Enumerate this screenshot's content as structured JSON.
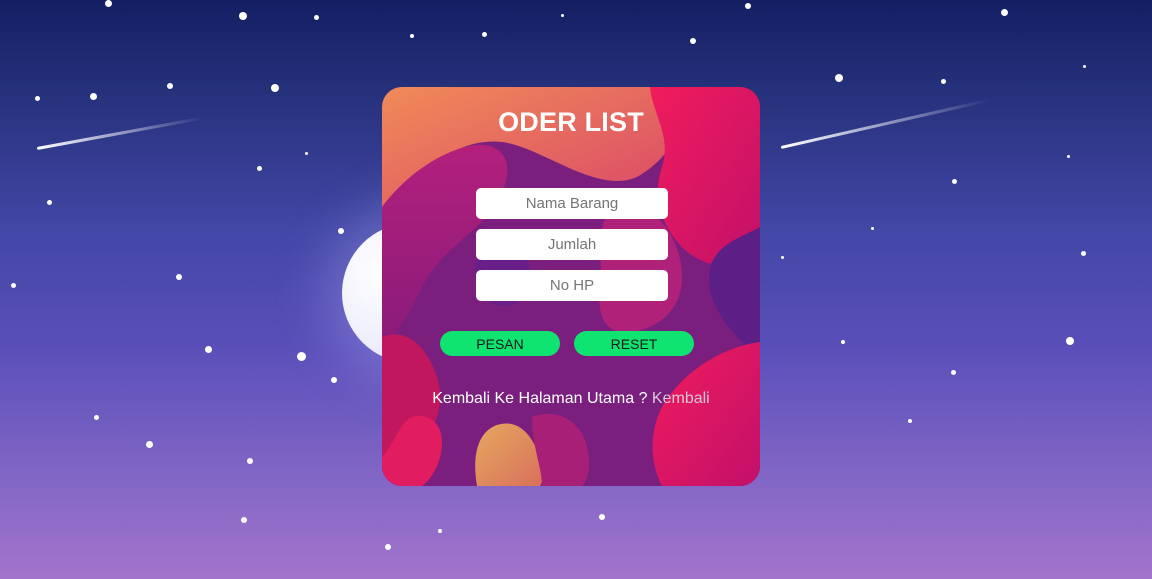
{
  "form": {
    "title": "ODER LIST",
    "fields": {
      "nama_barang": {
        "placeholder": "Nama Barang",
        "value": ""
      },
      "jumlah": {
        "placeholder": "Jumlah",
        "value": ""
      },
      "no_hp": {
        "placeholder": "No HP",
        "value": ""
      }
    },
    "buttons": {
      "pesan": "PESAN",
      "reset": "RESET"
    },
    "back": {
      "prompt": "Kembali Ke Halaman Utama ?",
      "link_label": "Kembali"
    }
  },
  "colors": {
    "sky_top": "#141e63",
    "sky_bottom": "#a374cc",
    "card_base": "#7a1f7e",
    "blob_pink": "#e3145f",
    "blob_orange": "#ef8a5c",
    "button_green": "#0fe370",
    "link_color": "#dcc8d8"
  }
}
